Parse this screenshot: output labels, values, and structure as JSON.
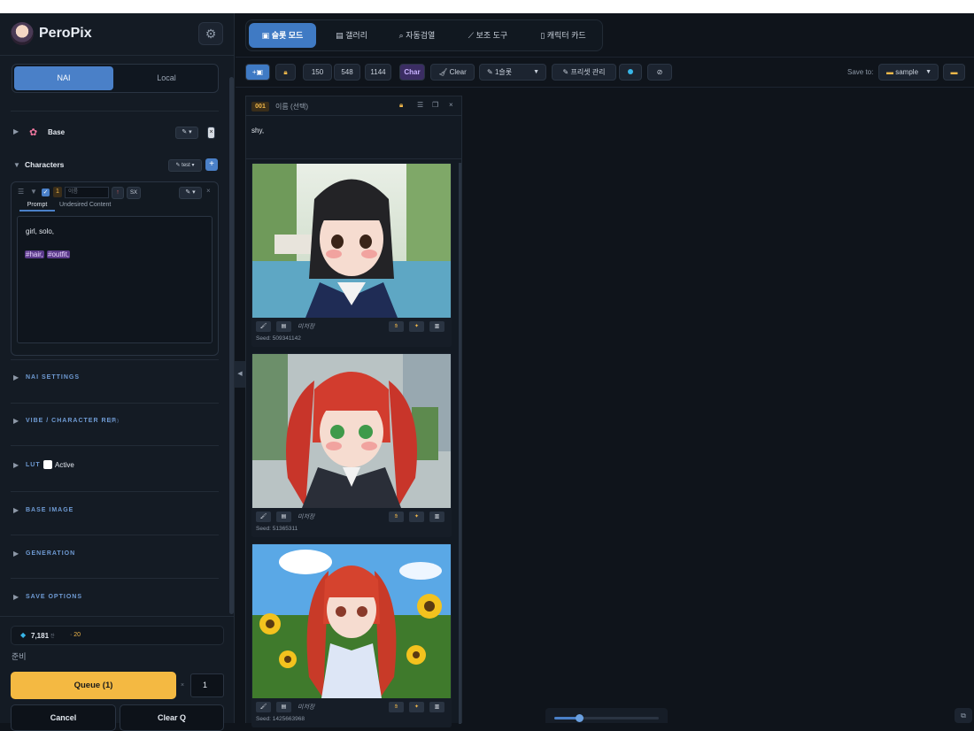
{
  "app": {
    "name": "PeroPix"
  },
  "sidebar": {
    "mode_nai": "NAI",
    "mode_local": "Local",
    "base_label": "Base",
    "characters_label": "Characters",
    "preset_test": "test ▾",
    "card": {
      "index": "1",
      "name_placeholder": "이름",
      "sx": "SX",
      "tab_prompt": "Prompt",
      "tab_uc": "Undesired Content",
      "prompt_line1": "girl, solo,",
      "tag_hair": "#hair,",
      "tag_outfit": "#outfit,"
    },
    "sections": {
      "nai_settings": "NAI SETTINGS",
      "vibe": "VIBE / CHARACTER REF",
      "vibe_sub": "(맥)",
      "lut": "LUT",
      "lut_active": "Active",
      "base_image": "BASE IMAGE",
      "generation": "GENERATION",
      "save_options": "SAVE OPTIONS"
    },
    "anlas": {
      "value": "7,181",
      "sub": "잔",
      "cost": "· 20"
    },
    "status": "준비",
    "queue_label": "Queue (1)",
    "quantity": "1",
    "cancel_label": "Cancel",
    "clear_q_label": "Clear Q"
  },
  "nav": {
    "tabs": [
      {
        "icon": "▣",
        "label": "슬롯 모드"
      },
      {
        "icon": "▤",
        "label": "갤러리"
      },
      {
        "icon": "⌕",
        "label": "자동검열"
      },
      {
        "icon": "⟋",
        "label": "보조 도구"
      },
      {
        "icon": "▯",
        "label": "캐릭터 카드"
      }
    ]
  },
  "toolbar": {
    "width": "150",
    "height_a": "548",
    "height_b": "1144",
    "char_label": "Char",
    "clear_label": "Clear",
    "slots_label": "1슬롯",
    "preset_label": "프리셋 관리",
    "save_to_label": "Save to:",
    "save_folder": "sample"
  },
  "slot": {
    "number": "001",
    "name_placeholder": "이름 (선택)",
    "prompt": "shy,",
    "images": [
      {
        "status": "미저장",
        "seed": "Seed: 509341142"
      },
      {
        "status": "미저장",
        "seed": "Seed: 51365311"
      },
      {
        "status": "미저장",
        "seed": "Seed: 1425663968"
      }
    ]
  },
  "colors": {
    "accent": "#4a80c8",
    "queue": "#f4b942",
    "tag": "#5b3a8a",
    "badge": "#f1b84a"
  },
  "icons": [
    "gear-icon",
    "flower-icon",
    "pencil-icon",
    "lock-icon",
    "gem-icon",
    "folder-icon",
    "link-icon"
  ]
}
